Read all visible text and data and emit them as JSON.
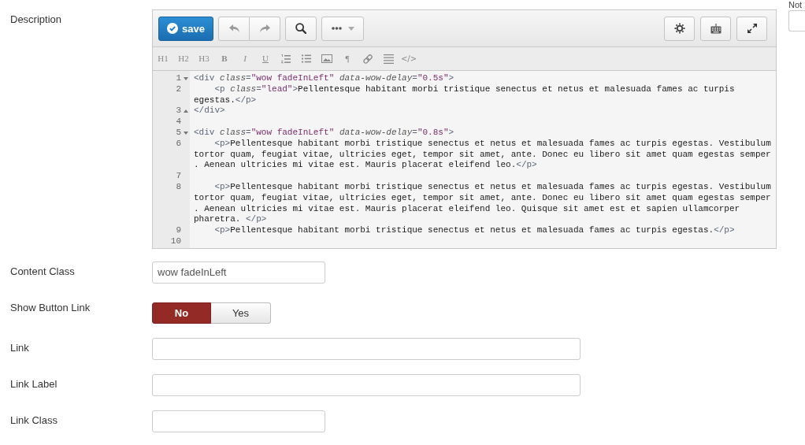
{
  "description": {
    "label": "Description"
  },
  "side_field": {
    "label": "Not"
  },
  "editor": {
    "save_button": {
      "label": "save"
    },
    "format_buttons": [
      {
        "kind": "heading",
        "label": "H1"
      },
      {
        "kind": "heading",
        "label": "H2"
      },
      {
        "kind": "heading",
        "label": "H3"
      },
      {
        "kind": "bold",
        "label": "B"
      },
      {
        "kind": "italic",
        "label": "I"
      },
      {
        "kind": "underline",
        "label": "U"
      },
      {
        "kind": "ordered-list"
      },
      {
        "kind": "bullet-list"
      },
      {
        "kind": "image"
      },
      {
        "kind": "paragraph",
        "label": "¶"
      },
      {
        "kind": "link"
      },
      {
        "kind": "rule"
      },
      {
        "kind": "source",
        "label": "</>"
      }
    ],
    "lines": [
      {
        "number": "1",
        "kind": "fold-start",
        "rows": [
          [
            {
              "kind": "tag",
              "text": "<div "
            },
            {
              "kind": "attr",
              "text": "class"
            },
            {
              "kind": "tag",
              "text": "="
            },
            {
              "kind": "string",
              "text": "\"wow fadeInLeft\""
            },
            {
              "kind": "tag",
              "text": " "
            },
            {
              "kind": "attr",
              "text": "data-wow-delay"
            },
            {
              "kind": "tag",
              "text": "="
            },
            {
              "kind": "string",
              "text": "\"0.5s\""
            },
            {
              "kind": "tag",
              "text": ">"
            }
          ]
        ]
      },
      {
        "number": "2",
        "kind": "plain",
        "rows": [
          [
            {
              "kind": "tag",
              "text": "    <p "
            },
            {
              "kind": "attr",
              "text": "class"
            },
            {
              "kind": "tag",
              "text": "="
            },
            {
              "kind": "string",
              "text": "\"lead\""
            },
            {
              "kind": "tag",
              "text": ">"
            },
            {
              "kind": "text",
              "text": "Pellentesque habitant morbi tristique senectus et netus et malesuada fames ac turpis"
            }
          ],
          [
            {
              "kind": "text",
              "text": "egestas."
            },
            {
              "kind": "tag",
              "text": "</p>"
            }
          ]
        ]
      },
      {
        "number": "3",
        "kind": "fold-end",
        "rows": [
          [
            {
              "kind": "tag",
              "text": "</div>"
            }
          ]
        ]
      },
      {
        "number": "4",
        "kind": "plain"
      },
      {
        "number": "5",
        "kind": "fold-start",
        "rows": [
          [
            {
              "kind": "tag",
              "text": "<div "
            },
            {
              "kind": "attr",
              "text": "class"
            },
            {
              "kind": "tag",
              "text": "="
            },
            {
              "kind": "string",
              "text": "\"wow fadeInLeft\""
            },
            {
              "kind": "tag",
              "text": " "
            },
            {
              "kind": "attr",
              "text": "data-wow-delay"
            },
            {
              "kind": "tag",
              "text": "="
            },
            {
              "kind": "string",
              "text": "\"0.8s\""
            },
            {
              "kind": "tag",
              "text": ">"
            }
          ]
        ]
      },
      {
        "number": "6",
        "kind": "plain",
        "rows": [
          [
            {
              "kind": "tag",
              "text": "    <p>"
            },
            {
              "kind": "text",
              "text": "Pellentesque habitant morbi tristique senectus et netus et malesuada fames ac turpis egestas. Vestibulum"
            }
          ],
          [
            {
              "kind": "text",
              "text": "tortor quam, feugiat vitae, ultricies eget, tempor sit amet, ante. Donec eu libero sit amet quam egestas semper"
            }
          ],
          [
            {
              "kind": "text",
              "text": ". Aenean ultricies mi vitae est. Mauris placerat eleifend leo."
            },
            {
              "kind": "tag",
              "text": "</p>"
            }
          ]
        ]
      },
      {
        "number": "7",
        "kind": "plain"
      },
      {
        "number": "8",
        "kind": "plain",
        "rows": [
          [
            {
              "kind": "tag",
              "text": "    <p>"
            },
            {
              "kind": "text",
              "text": "Pellentesque habitant morbi tristique senectus et netus et malesuada fames ac turpis egestas. Vestibulum"
            }
          ],
          [
            {
              "kind": "text",
              "text": "tortor quam, feugiat vitae, ultricies eget, tempor sit amet, ante. Donec eu libero sit amet quam egestas semper"
            }
          ],
          [
            {
              "kind": "text",
              "text": ". Aenean ultricies mi vitae est. Mauris placerat eleifend leo. Quisque sit amet est et sapien ullamcorper"
            }
          ],
          [
            {
              "kind": "text",
              "text": "pharetra. "
            },
            {
              "kind": "tag",
              "text": "</p>"
            }
          ]
        ]
      },
      {
        "number": "9",
        "kind": "plain",
        "rows": [
          [
            {
              "kind": "tag",
              "text": "    <p>"
            },
            {
              "kind": "text",
              "text": "Pellentesque habitant morbi tristique senectus et netus et malesuada fames ac turpis egestas."
            },
            {
              "kind": "tag",
              "text": "</p>"
            }
          ]
        ]
      },
      {
        "number": "10",
        "kind": "plain"
      }
    ]
  },
  "fields": [
    {
      "kind": "class",
      "label": "Content Class",
      "value": "wow fadeInLeft"
    },
    {
      "kind": "toggle",
      "label": "Show Button Link",
      "options": [
        {
          "label": "No",
          "selected": true
        },
        {
          "label": "Yes",
          "selected": false
        }
      ]
    },
    {
      "kind": "text",
      "label": "Link"
    },
    {
      "kind": "text",
      "label": "Link Label"
    },
    {
      "kind": "class",
      "label": "Link Class"
    }
  ]
}
